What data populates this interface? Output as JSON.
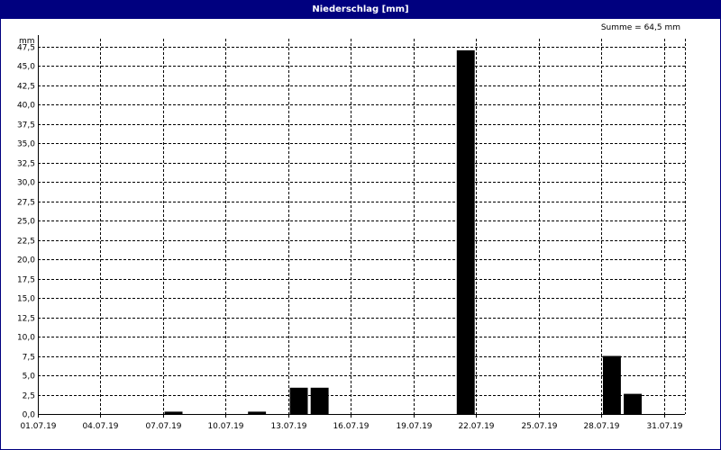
{
  "window": {
    "title": "Niederschlag [mm]",
    "summary": "Summe = 64,5 mm"
  },
  "colors": {
    "titlebar": "#00007f",
    "bars": "#000000",
    "grid": "#000000"
  },
  "chart_data": {
    "type": "bar",
    "title": "Niederschlag [mm]",
    "ylabel": "mm",
    "xlabel": "",
    "ylim": [
      0,
      48.5
    ],
    "yticks": [
      0,
      2.5,
      5,
      7.5,
      10,
      12.5,
      15,
      17.5,
      20,
      22.5,
      25,
      27.5,
      30,
      32.5,
      35,
      37.5,
      40,
      42.5,
      45,
      47.5
    ],
    "ytick_labels": [
      "0,0",
      "2,5",
      "5,0",
      "7,5",
      "10,0",
      "12,5",
      "15,0",
      "17,5",
      "20,0",
      "22,5",
      "25,0",
      "27,5",
      "30,0",
      "32,5",
      "35,0",
      "37,5",
      "40,0",
      "42,5",
      "45,0",
      "47,5"
    ],
    "xlim": [
      "01.07.19",
      "01.08.19"
    ],
    "xtick_labels": [
      "01.07.19",
      "04.07.19",
      "07.07.19",
      "10.07.19",
      "13.07.19",
      "16.07.19",
      "19.07.19",
      "22.07.19",
      "25.07.19",
      "28.07.19",
      "31.07.19"
    ],
    "grid": true,
    "grid_style": "dashed",
    "categories": [
      "01.07.19",
      "02.07.19",
      "03.07.19",
      "04.07.19",
      "05.07.19",
      "06.07.19",
      "07.07.19",
      "08.07.19",
      "09.07.19",
      "10.07.19",
      "11.07.19",
      "12.07.19",
      "13.07.19",
      "14.07.19",
      "15.07.19",
      "16.07.19",
      "17.07.19",
      "18.07.19",
      "19.07.19",
      "20.07.19",
      "21.07.19",
      "22.07.19",
      "23.07.19",
      "24.07.19",
      "25.07.19",
      "26.07.19",
      "27.07.19",
      "28.07.19",
      "29.07.19",
      "30.07.19",
      "31.07.19"
    ],
    "values": [
      0,
      0,
      0,
      0,
      0,
      0,
      0.3,
      0,
      0,
      0,
      0.3,
      0,
      3.4,
      3.4,
      0,
      0,
      0,
      0,
      0,
      0,
      47.0,
      0,
      0,
      0,
      0,
      0,
      0,
      7.5,
      2.6,
      0,
      0
    ]
  }
}
